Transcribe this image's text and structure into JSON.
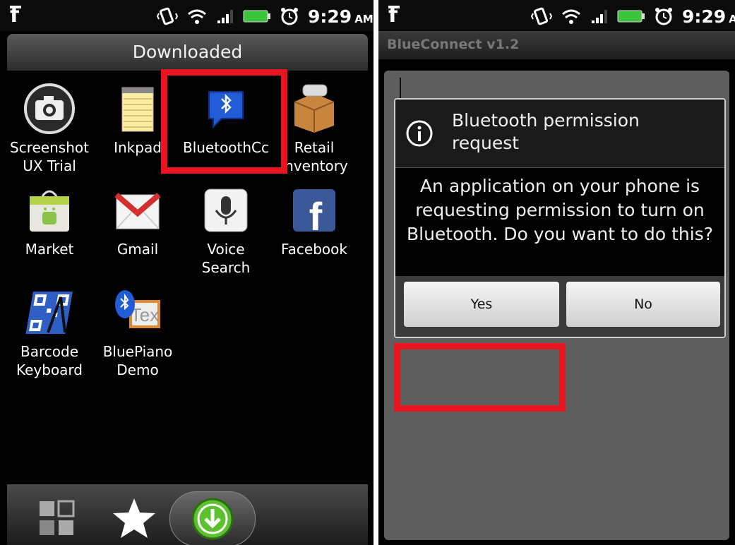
{
  "status_bar": {
    "time": "9:29",
    "ampm": "AM"
  },
  "left_screen": {
    "title": "Downloaded",
    "apps": [
      {
        "label": "Screenshot\nUX Trial",
        "icon": "camera-icon"
      },
      {
        "label": "Inkpad",
        "icon": "notepad-icon"
      },
      {
        "label": "BluetoothCc",
        "icon": "bluetooth-chat-icon"
      },
      {
        "label": "Retail\nInventory",
        "icon": "box-icon"
      },
      {
        "label": "Market",
        "icon": "market-bag-icon"
      },
      {
        "label": "Gmail",
        "icon": "gmail-icon"
      },
      {
        "label": "Voice\nSearch",
        "icon": "microphone-icon"
      },
      {
        "label": "Facebook",
        "icon": "facebook-icon"
      },
      {
        "label": "Barcode\nKeyboard",
        "icon": "qr-code-icon"
      },
      {
        "label": "BluePiano\nDemo",
        "icon": "bluetooth-text-icon"
      }
    ],
    "highlighted_app": "BluetoothCc",
    "dock": [
      "all-apps-icon",
      "favorites-star-icon",
      "downloaded-icon"
    ]
  },
  "right_screen": {
    "app_title": "BlueConnect v1.2",
    "dialog": {
      "title": "Bluetooth permission request",
      "message": "An application on your phone is requesting permission to turn on Bluetooth. Do you want to do this?",
      "yes_label": "Yes",
      "no_label": "No"
    },
    "highlighted_button": "Yes"
  },
  "colors": {
    "highlight": "#e8141f",
    "bluetooth": "#1f5cd6",
    "download_green": "#5bc12e"
  }
}
